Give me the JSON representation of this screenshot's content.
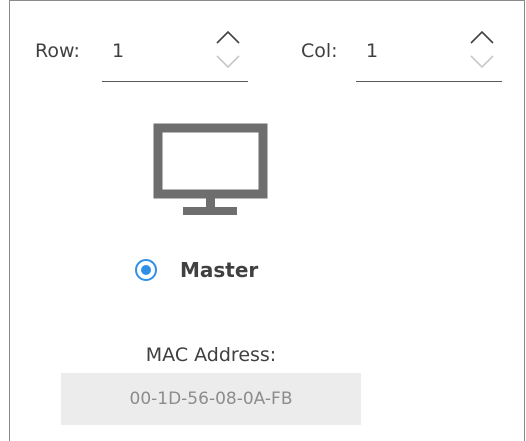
{
  "row": {
    "label": "Row:",
    "value": "1"
  },
  "col": {
    "label": "Col:",
    "value": "1"
  },
  "role": {
    "label": "Master",
    "selected": true,
    "accent_color": "#2f8fe8"
  },
  "mac": {
    "label": "MAC Address:",
    "value": "00-1D-56-08-0A-FB"
  },
  "icons": {
    "device": "monitor-icon",
    "increment": "chevron-up-icon",
    "decrement": "chevron-down-icon"
  }
}
